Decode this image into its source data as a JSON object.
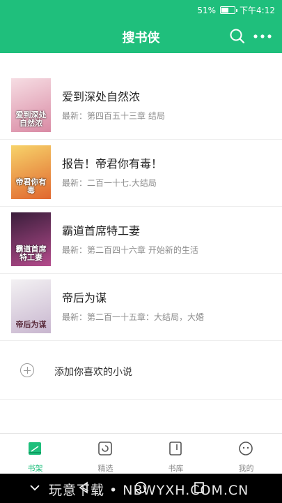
{
  "status_bar": {
    "battery": "51%",
    "time": "下午4:12",
    "battery_level": 0.51
  },
  "header": {
    "title": "搜书侠",
    "search_icon": "search-icon",
    "more_icon": "more-icon"
  },
  "books": [
    {
      "title": "爱到深处自然浓",
      "latest": "最新：第四百五十三章 结局",
      "cover_text": "爱到深处自然浓",
      "cover_colors": [
        "#f6dde3",
        "#d98aa4"
      ]
    },
    {
      "title": "报告！帝君你有毒！",
      "latest": "最新：二百一十七.大结局",
      "cover_text": "帝君你有毒",
      "cover_colors": [
        "#f7d36a",
        "#e0662e"
      ]
    },
    {
      "title": "霸道首席特工妻",
      "latest": "最新：第二百四十六章 开始新的生活",
      "cover_text": "霸道首席特工妻",
      "cover_colors": [
        "#3a1e3b",
        "#b44b8c"
      ]
    },
    {
      "title": "帝后为谋",
      "latest": "最新：第二百一十五章：大结局，大婚",
      "cover_text": "帝后为谋",
      "cover_colors": [
        "#f3f1f3",
        "#c8b6cf"
      ]
    }
  ],
  "add_novel": {
    "label": "添加你喜欢的小说",
    "icon": "plus-circle-icon"
  },
  "tabs": [
    {
      "label": "书架",
      "icon": "bookshelf-icon",
      "active": true
    },
    {
      "label": "精选",
      "icon": "featured-icon",
      "active": false
    },
    {
      "label": "书库",
      "icon": "library-icon",
      "active": false
    },
    {
      "label": "我的",
      "icon": "profile-icon",
      "active": false
    }
  ],
  "nav_bar": {
    "watermark": "玩意下载 • NBWYXH.COM.CN"
  },
  "colors": {
    "accent": "#1fbf7c",
    "text_primary": "#222222",
    "text_secondary": "#8e8e8e"
  }
}
